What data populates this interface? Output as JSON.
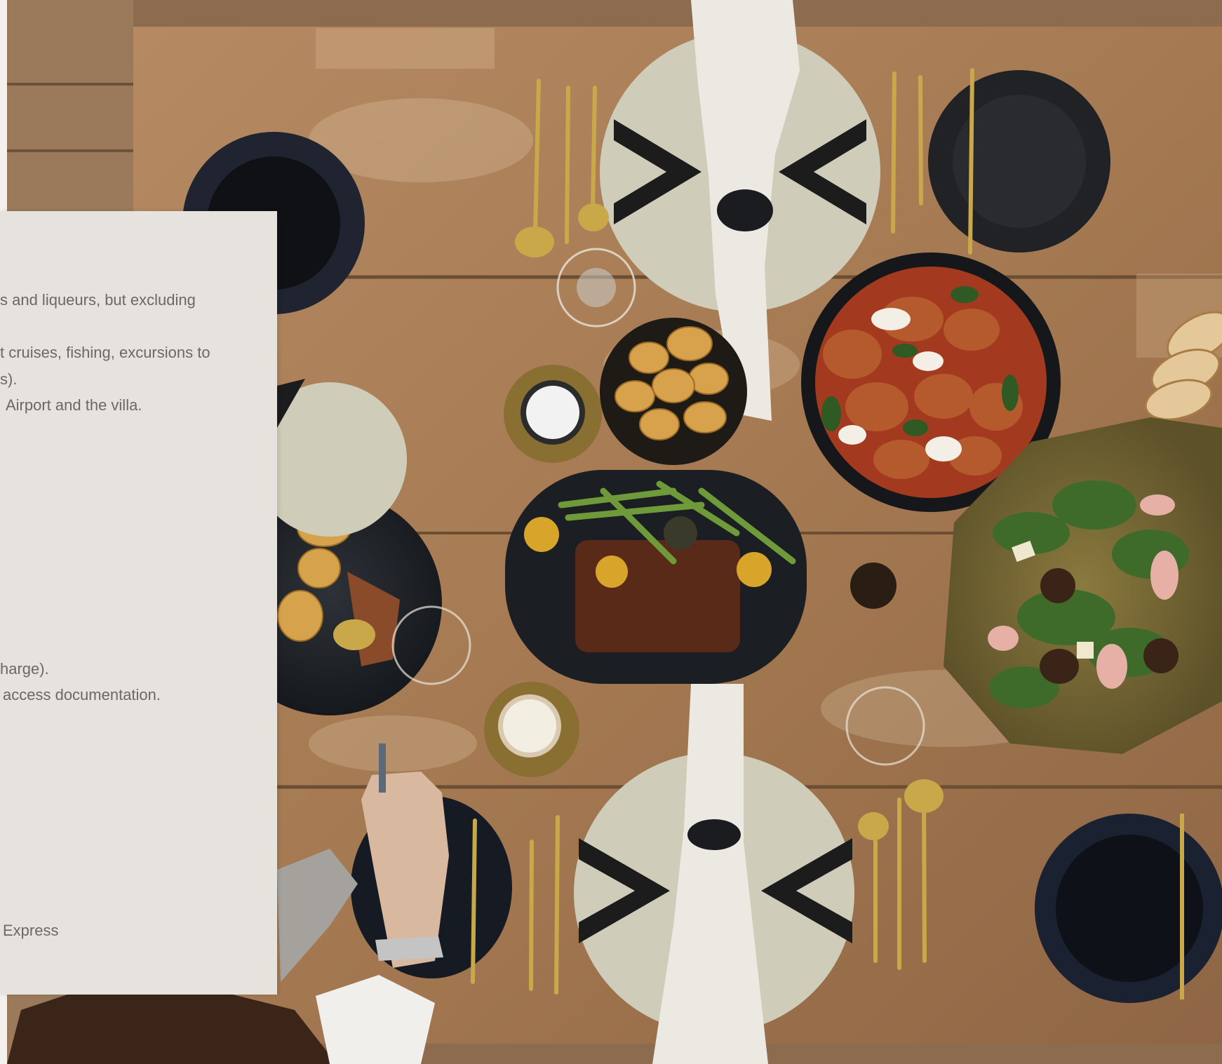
{
  "photo": {
    "subject": "overhead-dining-table",
    "colors": {
      "table_wood": "#a9805a",
      "panel_bg": "#e6e2dd",
      "panel_text": "#6e6862"
    }
  },
  "panel": {
    "lines": [
      "s and liqueurs, but excluding",
      "t cruises, fishing, excursions to",
      "s).",
      "Airport and the villa.",
      "harge).",
      "access documentation.",
      "Express"
    ]
  }
}
